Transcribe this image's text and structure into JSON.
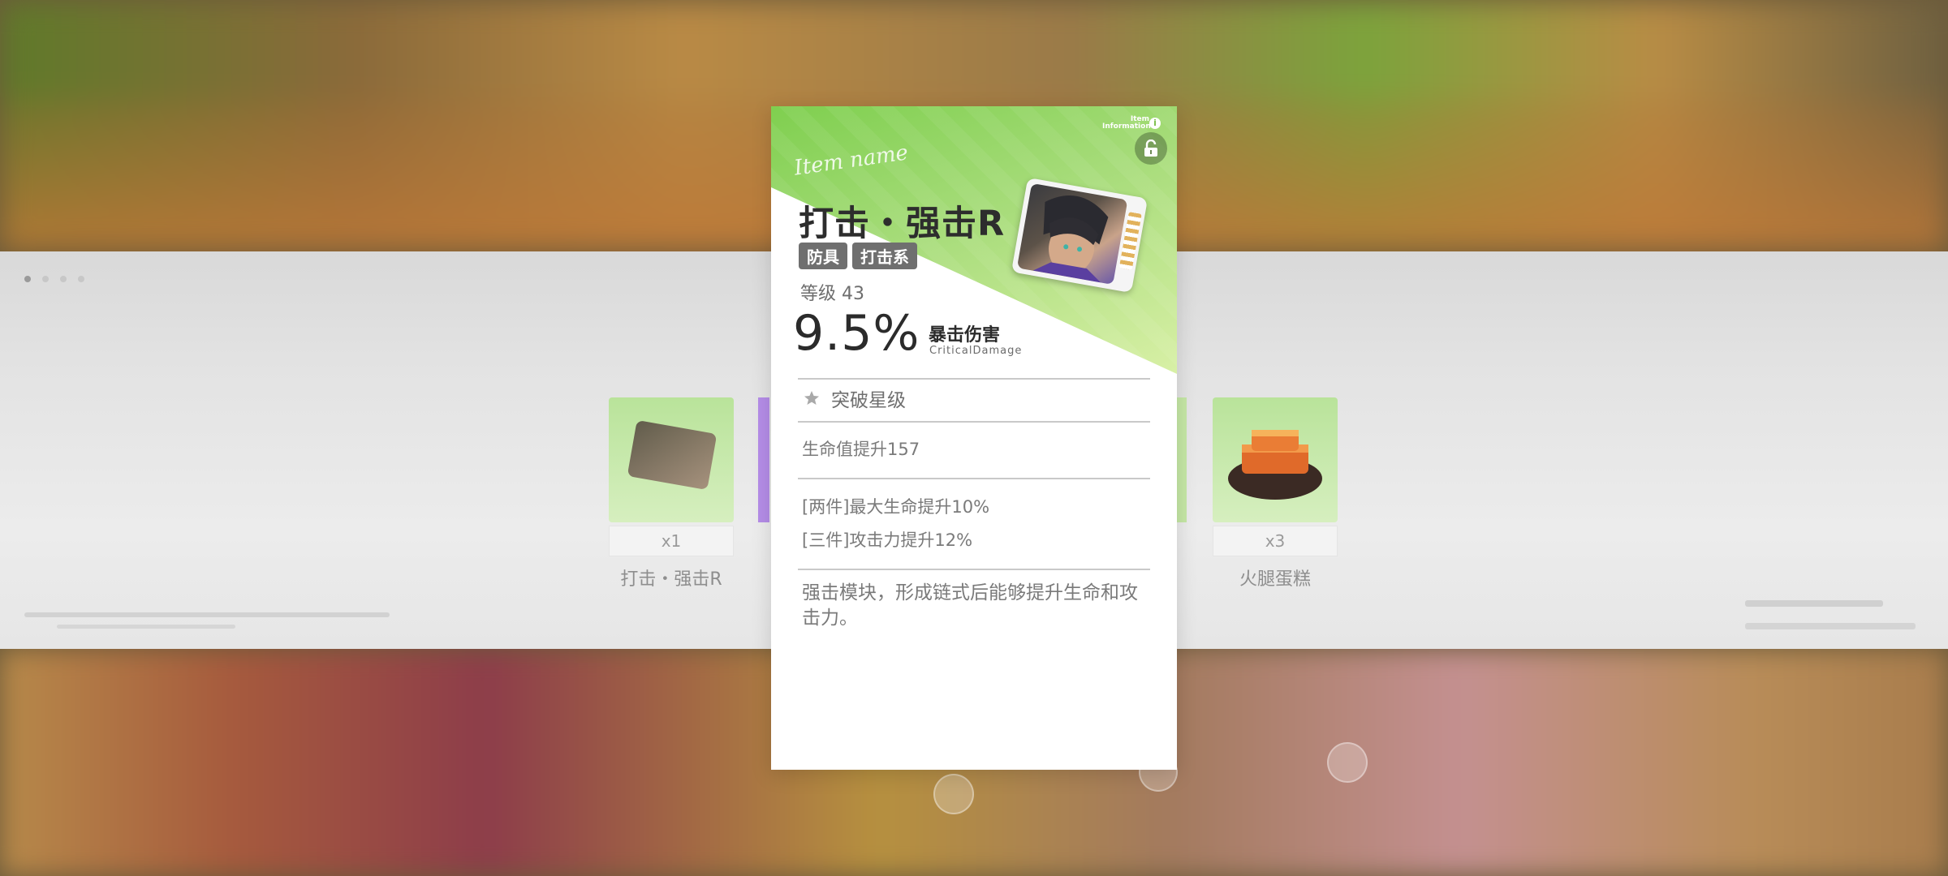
{
  "item": {
    "info_label": "Item Information",
    "script_label": "Item name",
    "title": "打击・强击R",
    "tags": [
      "防具",
      "打击系"
    ],
    "level_text": "等级 43",
    "main_stat": {
      "value": "9.5%",
      "name": "暴击伤害",
      "name_en": "CriticalDamage"
    },
    "breakthrough_label": "突破星级",
    "sub_stat": "生命值提升157",
    "set_bonuses": [
      "[两件]最大生命提升10%",
      "[三件]攻击力提升12%"
    ],
    "description": "强击模块，形成链式后能够提升生命和攻击力。"
  },
  "background_items": [
    {
      "qty": "x1",
      "name": "打击・强击R"
    },
    {
      "qty": "x3",
      "name": "火腿蛋糕"
    }
  ],
  "colors": {
    "card_accent": "#7fcf4f",
    "tag_bg": "#6f6f6f"
  },
  "icons": [
    "info-icon",
    "lock-icon",
    "star-icon"
  ]
}
